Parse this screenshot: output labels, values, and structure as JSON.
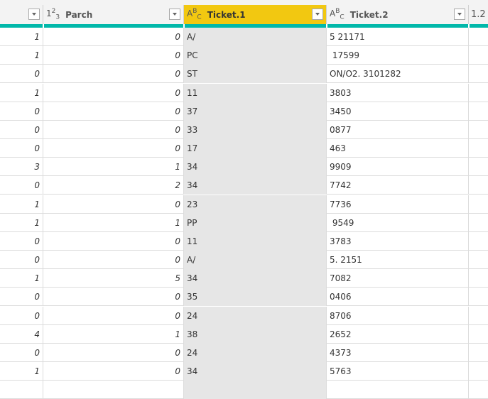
{
  "columns": [
    {
      "label": "",
      "type_icon": ""
    },
    {
      "label": "Parch",
      "type_icon": "whole-number-icon",
      "type_text": "123"
    },
    {
      "label": "Ticket.1",
      "type_icon": "text-type-icon",
      "type_text": "ABC",
      "selected": true
    },
    {
      "label": "Ticket.2",
      "type_icon": "text-type-icon",
      "type_text": "ABC"
    },
    {
      "label": "1.2",
      "type_icon": ""
    }
  ],
  "colors": {
    "selected_header": "#f2c811",
    "quality_bar": "#01b8aa",
    "selected_column": "#e6e6e6"
  },
  "rows": [
    [
      "1",
      "0",
      "A/",
      "5 21171"
    ],
    [
      "1",
      "0",
      "PC",
      " 17599"
    ],
    [
      "0",
      "0",
      "ST",
      "ON/O2. 3101282"
    ],
    [
      "1",
      "0",
      "11",
      "3803"
    ],
    [
      "0",
      "0",
      "37",
      "3450"
    ],
    [
      "0",
      "0",
      "33",
      "0877"
    ],
    [
      "0",
      "0",
      "17",
      "463"
    ],
    [
      "3",
      "1",
      "34",
      "9909"
    ],
    [
      "0",
      "2",
      "34",
      "7742"
    ],
    [
      "1",
      "0",
      "23",
      "7736"
    ],
    [
      "1",
      "1",
      "PP",
      " 9549"
    ],
    [
      "0",
      "0",
      "11",
      "3783"
    ],
    [
      "0",
      "0",
      "A/",
      "5. 2151"
    ],
    [
      "1",
      "5",
      "34",
      "7082"
    ],
    [
      "0",
      "0",
      "35",
      "0406"
    ],
    [
      "0",
      "0",
      "24",
      "8706"
    ],
    [
      "4",
      "1",
      "38",
      "2652"
    ],
    [
      "0",
      "0",
      "24",
      "4373"
    ],
    [
      "1",
      "0",
      "34",
      "5763"
    ]
  ]
}
